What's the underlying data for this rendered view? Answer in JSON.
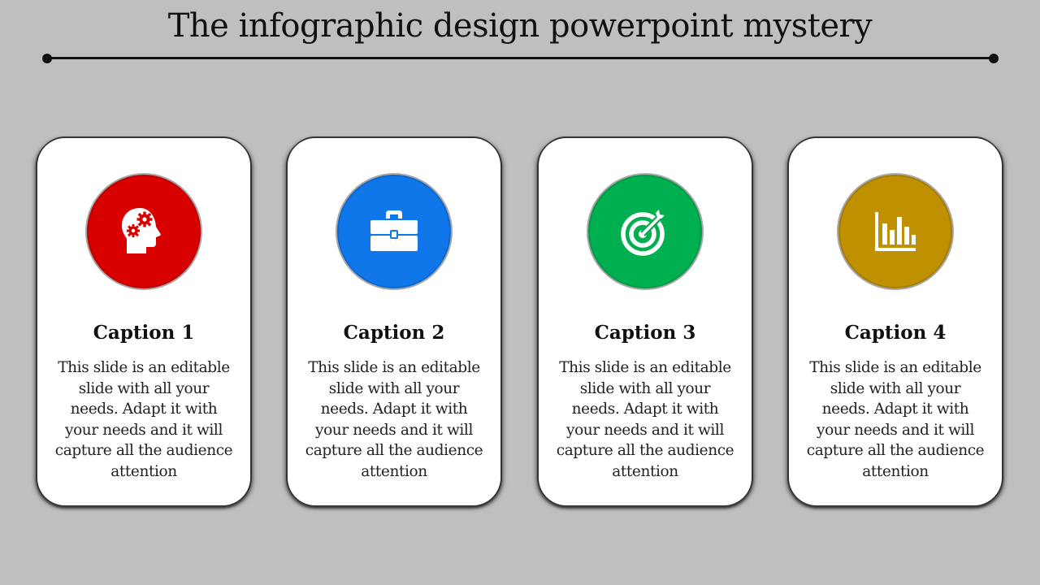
{
  "slide": {
    "title": "The infographic design powerpoint mystery"
  },
  "cards": [
    {
      "caption": "Caption 1",
      "text": "This slide is an editable slide with all your needs. Adapt it with your needs and it will capture all the audience attention",
      "icon": "head-gears-icon",
      "color": "#d90000"
    },
    {
      "caption": "Caption 2",
      "text": "This slide is an editable slide with all your needs. Adapt it with your needs and it will capture all the audience attention",
      "icon": "briefcase-icon",
      "color": "#0f77ea"
    },
    {
      "caption": "Caption 3",
      "text": "This slide is an editable slide with all your needs. Adapt it with your needs and it will capture all the audience attention",
      "icon": "target-arrow-icon",
      "color": "#00b050"
    },
    {
      "caption": "Caption 4",
      "text": "This slide is an editable slide with all your needs. Adapt it with your needs and it will capture all the audience attention",
      "icon": "bar-chart-icon",
      "color": "#bf9000"
    }
  ]
}
